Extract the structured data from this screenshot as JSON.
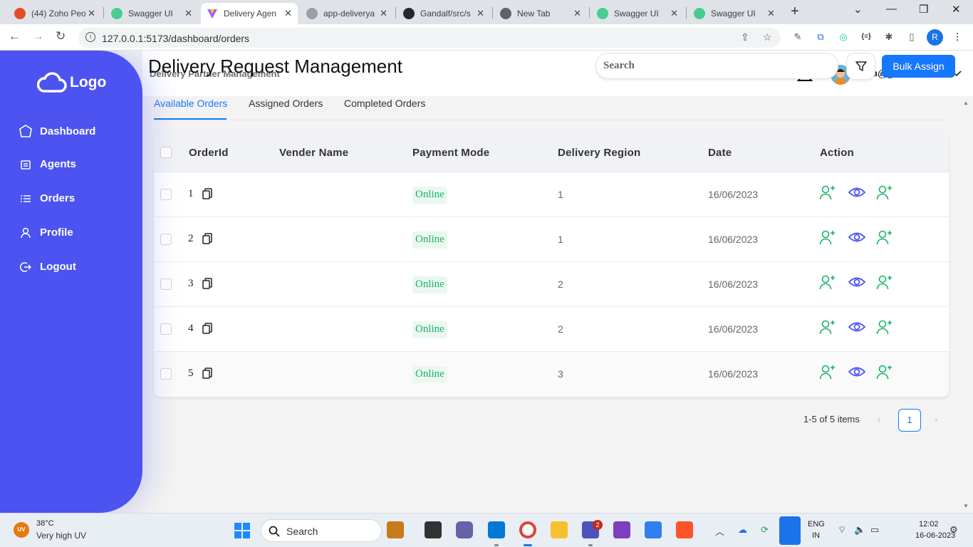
{
  "browser": {
    "tabs": [
      {
        "title": "(44) Zoho Peo",
        "color": "#e44d26"
      },
      {
        "title": "Swagger UI",
        "color": "#49cc90"
      },
      {
        "title": "Delivery Agen",
        "color": "#a259ff"
      },
      {
        "title": "app-deliverya",
        "color": "#9aa0a6"
      },
      {
        "title": "Gandalf/src/s",
        "color": "#24292e"
      },
      {
        "title": "New Tab",
        "color": "#5f6368"
      },
      {
        "title": "Swagger UI",
        "color": "#49cc90"
      },
      {
        "title": "Swagger UI",
        "color": "#49cc90"
      }
    ],
    "url": "127.0.0.1:5173/dashboard/orders",
    "profile_initial": "R"
  },
  "sidebar": {
    "logo": "Logo",
    "items": [
      {
        "label": "Dashboard",
        "icon": "home-icon"
      },
      {
        "label": "Agents",
        "icon": "agents-icon"
      },
      {
        "label": "Orders",
        "icon": "list-icon"
      },
      {
        "label": "Profile",
        "icon": "user-icon"
      },
      {
        "label": "Logout",
        "icon": "logout-icon"
      }
    ]
  },
  "header": {
    "title": "Delivery Partner Management",
    "user_email": "olivia@gmail.com"
  },
  "main": {
    "title": "Delivery Request Management",
    "search_placeholder": "Search",
    "bulk_assign_label": "Bulk Assign",
    "tabs": [
      {
        "label": "Available Orders",
        "active": true
      },
      {
        "label": "Assigned Orders",
        "active": false
      },
      {
        "label": "Completed Orders",
        "active": false
      }
    ]
  },
  "table": {
    "columns": [
      "OrderId",
      "Vender Name",
      "Payment Mode",
      "Delivery Region",
      "Date",
      "Action"
    ],
    "rows": [
      {
        "order_id": "1",
        "vendor": "",
        "payment": "Online",
        "region": "1",
        "date": "16/06/2023"
      },
      {
        "order_id": "2",
        "vendor": "",
        "payment": "Online",
        "region": "1",
        "date": "16/06/2023"
      },
      {
        "order_id": "3",
        "vendor": "",
        "payment": "Online",
        "region": "2",
        "date": "16/06/2023"
      },
      {
        "order_id": "4",
        "vendor": "",
        "payment": "Online",
        "region": "2",
        "date": "16/06/2023"
      },
      {
        "order_id": "5",
        "vendor": "",
        "payment": "Online",
        "region": "3",
        "date": "16/06/2023"
      }
    ]
  },
  "pagination": {
    "info": "1-5 of 5 items",
    "current_page": "1"
  },
  "taskbar": {
    "weather_badge": "UV",
    "temperature": "38°C",
    "weather_desc": "Very high UV",
    "search_label": "Search",
    "lang_line1": "ENG",
    "lang_line2": "IN",
    "time": "12:02",
    "date": "16-06-2023",
    "teams_badge": "2"
  },
  "colors": {
    "sidebar": "#4c53f0",
    "primary": "#1677ff",
    "success": "#1bb36a"
  }
}
